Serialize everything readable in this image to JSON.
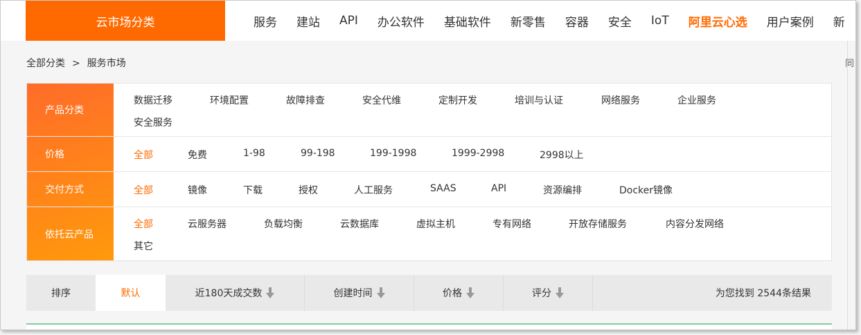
{
  "header": {
    "category_button": "云市场分类",
    "nav": [
      "服务",
      "建站",
      "API",
      "办公软件",
      "基础软件",
      "新零售",
      "容器",
      "安全",
      "IoT",
      "阿里云心选",
      "用户案例",
      "新"
    ],
    "highlight_index": 9,
    "accent_color": "#ff6a00"
  },
  "breadcrumb": {
    "root": "全部分类",
    "separator": ">",
    "current": "服务市场"
  },
  "right_edge_text": "同",
  "filters": {
    "product": {
      "label": "产品分类",
      "options": [
        "数据迁移",
        "环境配置",
        "故障排查",
        "安全代维",
        "定制开发",
        "培训与认证",
        "网络服务",
        "企业服务",
        "安全服务"
      ]
    },
    "price": {
      "label": "价格",
      "options": [
        "全部",
        "免费",
        "1-98",
        "99-198",
        "199-1998",
        "1999-2998",
        "2998以上"
      ]
    },
    "delivery": {
      "label": "交付方式",
      "options": [
        "全部",
        "镜像",
        "下载",
        "授权",
        "人工服务",
        "SAAS",
        "API",
        "资源编排",
        "Docker镜像"
      ]
    },
    "cloud": {
      "label": "依托云产品",
      "options": [
        "全部",
        "云服务器",
        "负载均衡",
        "云数据库",
        "虚拟主机",
        "专有网络",
        "开放存储服务",
        "内容分发网络",
        "其它"
      ]
    }
  },
  "sort": {
    "label": "排序",
    "default": "默认",
    "deals": "近180天成交数",
    "created": "创建时间",
    "price": "价格",
    "rating": "评分",
    "result_text": "为您找到 2544条结果"
  }
}
